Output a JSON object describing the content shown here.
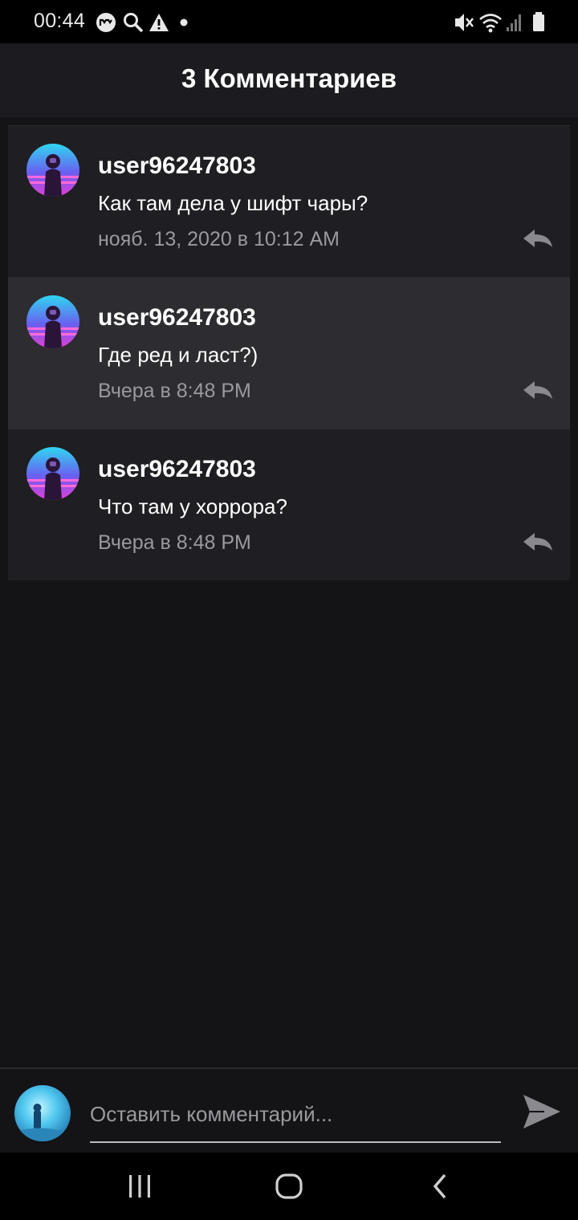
{
  "status_bar": {
    "time": "00:44",
    "icons": [
      "messenger-icon",
      "search-icon",
      "warning-icon",
      "dot-icon",
      "mute-icon",
      "wifi-icon",
      "signal-icon",
      "battery-icon"
    ]
  },
  "header": {
    "title": "3 Комментариев"
  },
  "comments": [
    {
      "username": "user96247803",
      "text": "Как там дела у шифт чары?",
      "time": "нояб. 13, 2020 в 10:12 AM",
      "highlighted": false
    },
    {
      "username": "user96247803",
      "text": "Где ред и ласт?)",
      "time": "Вчера в 8:48 PM",
      "highlighted": true
    },
    {
      "username": "user96247803",
      "text": "Что там у хоррора?",
      "time": "Вчера в 8:48 PM",
      "highlighted": false
    }
  ],
  "input": {
    "placeholder": "Оставить комментарий...",
    "value": ""
  },
  "nav": {
    "icons": [
      "recent-apps-icon",
      "home-icon",
      "back-icon"
    ]
  },
  "colors": {
    "background": "#141316",
    "card": "#1f1e22",
    "card_highlight": "#2d2c30",
    "muted_text": "#9a999e"
  }
}
